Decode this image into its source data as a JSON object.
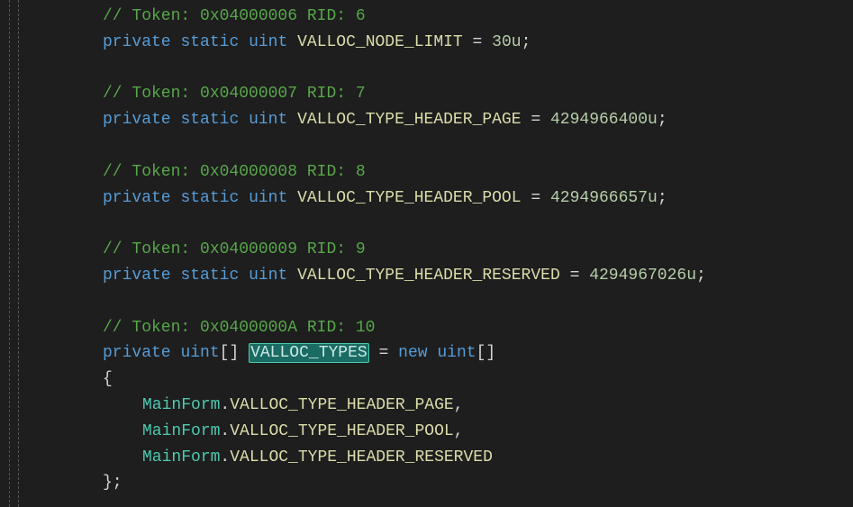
{
  "code": {
    "lines": [
      {
        "indent": 1,
        "tokens": [
          {
            "t": "// Token: 0x04000006 RID: 6",
            "c": "c-comment"
          }
        ]
      },
      {
        "indent": 1,
        "tokens": [
          {
            "t": "private",
            "c": "c-keyword"
          },
          {
            "t": " "
          },
          {
            "t": "static",
            "c": "c-keyword"
          },
          {
            "t": " "
          },
          {
            "t": "uint",
            "c": "c-type"
          },
          {
            "t": " "
          },
          {
            "t": "VALLOC_NODE_LIMIT",
            "c": "c-fieldw"
          },
          {
            "t": " "
          },
          {
            "t": "=",
            "c": "c-op"
          },
          {
            "t": " "
          },
          {
            "t": "30u",
            "c": "c-num"
          },
          {
            "t": ";",
            "c": "c-punct"
          }
        ]
      },
      {
        "indent": 1,
        "tokens": []
      },
      {
        "indent": 1,
        "tokens": [
          {
            "t": "// Token: 0x04000007 RID: 7",
            "c": "c-comment"
          }
        ]
      },
      {
        "indent": 1,
        "tokens": [
          {
            "t": "private",
            "c": "c-keyword"
          },
          {
            "t": " "
          },
          {
            "t": "static",
            "c": "c-keyword"
          },
          {
            "t": " "
          },
          {
            "t": "uint",
            "c": "c-type"
          },
          {
            "t": " "
          },
          {
            "t": "VALLOC_TYPE_HEADER_PAGE",
            "c": "c-fieldw"
          },
          {
            "t": " "
          },
          {
            "t": "=",
            "c": "c-op"
          },
          {
            "t": " "
          },
          {
            "t": "4294966400u",
            "c": "c-num"
          },
          {
            "t": ";",
            "c": "c-punct"
          }
        ]
      },
      {
        "indent": 1,
        "tokens": []
      },
      {
        "indent": 1,
        "tokens": [
          {
            "t": "// Token: 0x04000008 RID: 8",
            "c": "c-comment"
          }
        ]
      },
      {
        "indent": 1,
        "tokens": [
          {
            "t": "private",
            "c": "c-keyword"
          },
          {
            "t": " "
          },
          {
            "t": "static",
            "c": "c-keyword"
          },
          {
            "t": " "
          },
          {
            "t": "uint",
            "c": "c-type"
          },
          {
            "t": " "
          },
          {
            "t": "VALLOC_TYPE_HEADER_POOL",
            "c": "c-fieldw"
          },
          {
            "t": " "
          },
          {
            "t": "=",
            "c": "c-op"
          },
          {
            "t": " "
          },
          {
            "t": "4294966657u",
            "c": "c-num"
          },
          {
            "t": ";",
            "c": "c-punct"
          }
        ]
      },
      {
        "indent": 1,
        "tokens": []
      },
      {
        "indent": 1,
        "tokens": [
          {
            "t": "// Token: 0x04000009 RID: 9",
            "c": "c-comment"
          }
        ]
      },
      {
        "indent": 1,
        "tokens": [
          {
            "t": "private",
            "c": "c-keyword"
          },
          {
            "t": " "
          },
          {
            "t": "static",
            "c": "c-keyword"
          },
          {
            "t": " "
          },
          {
            "t": "uint",
            "c": "c-type"
          },
          {
            "t": " "
          },
          {
            "t": "VALLOC_TYPE_HEADER_RESERVED",
            "c": "c-fieldw"
          },
          {
            "t": " "
          },
          {
            "t": "=",
            "c": "c-op"
          },
          {
            "t": " "
          },
          {
            "t": "4294967026u",
            "c": "c-num"
          },
          {
            "t": ";",
            "c": "c-punct"
          }
        ]
      },
      {
        "indent": 1,
        "tokens": []
      },
      {
        "indent": 1,
        "tokens": [
          {
            "t": "// Token: 0x0400000A RID: 10",
            "c": "c-comment"
          }
        ]
      },
      {
        "indent": 1,
        "tokens": [
          {
            "t": "private",
            "c": "c-keyword"
          },
          {
            "t": " "
          },
          {
            "t": "uint",
            "c": "c-type"
          },
          {
            "t": "[]",
            "c": "c-punct"
          },
          {
            "t": " "
          },
          {
            "t": "VALLOC_TYPES",
            "c": "c-fieldw",
            "hl": true
          },
          {
            "t": " "
          },
          {
            "t": "=",
            "c": "c-op"
          },
          {
            "t": " "
          },
          {
            "t": "new",
            "c": "c-keyword"
          },
          {
            "t": " "
          },
          {
            "t": "uint",
            "c": "c-type"
          },
          {
            "t": "[]",
            "c": "c-punct"
          }
        ]
      },
      {
        "indent": 1,
        "tokens": [
          {
            "t": "{",
            "c": "c-punct"
          }
        ]
      },
      {
        "indent": 2,
        "tokens": [
          {
            "t": "MainForm",
            "c": "c-class"
          },
          {
            "t": ".",
            "c": "c-punct"
          },
          {
            "t": "VALLOC_TYPE_HEADER_PAGE",
            "c": "c-fieldw"
          },
          {
            "t": ",",
            "c": "c-punct"
          }
        ]
      },
      {
        "indent": 2,
        "tokens": [
          {
            "t": "MainForm",
            "c": "c-class"
          },
          {
            "t": ".",
            "c": "c-punct"
          },
          {
            "t": "VALLOC_TYPE_HEADER_POOL",
            "c": "c-fieldw"
          },
          {
            "t": ",",
            "c": "c-punct"
          }
        ]
      },
      {
        "indent": 2,
        "tokens": [
          {
            "t": "MainForm",
            "c": "c-class"
          },
          {
            "t": ".",
            "c": "c-punct"
          },
          {
            "t": "VALLOC_TYPE_HEADER_RESERVED",
            "c": "c-fieldw"
          }
        ]
      },
      {
        "indent": 1,
        "tokens": [
          {
            "t": "};",
            "c": "c-punct"
          }
        ]
      }
    ]
  }
}
